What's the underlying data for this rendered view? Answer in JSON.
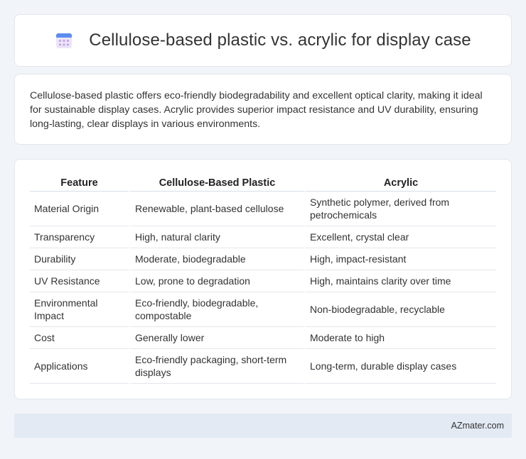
{
  "header": {
    "title": "Cellulose-based plastic vs. acrylic for display case",
    "icon": "calendar-icon",
    "icon_colors": {
      "top": "#5b8def",
      "grid": "#c9a7e8",
      "body": "#e9e1f7"
    }
  },
  "intro": {
    "text": "Cellulose-based plastic offers eco-friendly biodegradability and excellent optical clarity, making it ideal for sustainable display cases. Acrylic provides superior impact resistance and UV durability, ensuring long-lasting, clear displays in various environments."
  },
  "table": {
    "headers": [
      "Feature",
      "Cellulose-Based Plastic",
      "Acrylic"
    ],
    "rows": [
      [
        "Material Origin",
        "Renewable, plant-based cellulose",
        "Synthetic polymer, derived from petrochemicals"
      ],
      [
        "Transparency",
        "High, natural clarity",
        "Excellent, crystal clear"
      ],
      [
        "Durability",
        "Moderate, biodegradable",
        "High, impact-resistant"
      ],
      [
        "UV Resistance",
        "Low, prone to degradation",
        "High, maintains clarity over time"
      ],
      [
        "Environmental Impact",
        "Eco-friendly, biodegradable, compostable",
        "Non-biodegradable, recyclable"
      ],
      [
        "Cost",
        "Generally lower",
        "Moderate to high"
      ],
      [
        "Applications",
        "Eco-friendly packaging, short-term displays",
        "Long-term, durable display cases"
      ]
    ]
  },
  "footer": {
    "text": "AZmater.com"
  }
}
